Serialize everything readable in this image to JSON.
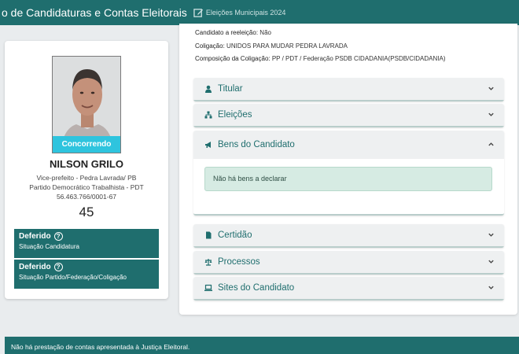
{
  "header": {
    "title": "o de Candidaturas e Contas Eleitorais",
    "subtitle": "Eleições Municipais 2024",
    "edit_icon": "edit-icon"
  },
  "candidate": {
    "status_badge": "Concorrendo",
    "name": "NILSON GRILO",
    "office": "Vice-prefeito - Pedra Lavrada/ PB",
    "party": "Partido Democrático Trabalhista - PDT",
    "cnpj": "56.463.766/0001-67",
    "number": "45",
    "statuses": [
      {
        "title": "Deferido",
        "subtitle": "Situação Candidatura",
        "icon": "question-circle-icon"
      },
      {
        "title": "Deferido",
        "subtitle": "Situação Partido/Federação/Coligação",
        "icon": "question-circle-icon"
      }
    ]
  },
  "details": {
    "reelection_label": "Candidato a reeleição:",
    "reelection_value": "Não",
    "coalition_label": "Coligação:",
    "coalition_value": "UNIDOS PARA MUDAR PEDRA LAVRADA",
    "composition_label": "Composição da Coligação:",
    "composition_value": "PP / PDT / Federação PSDB CIDADANIA(PSDB/CIDADANIA)"
  },
  "accordion": [
    {
      "label": "Titular",
      "icon": "user-icon",
      "expanded": false
    },
    {
      "label": "Eleições",
      "icon": "sitemap-icon",
      "expanded": false
    },
    {
      "label": "Bens do Candidato",
      "icon": "bullhorn-icon",
      "expanded": true,
      "content": "Não há bens a declarar"
    },
    {
      "label": "Certidão",
      "icon": "file-icon",
      "expanded": false
    },
    {
      "label": "Processos",
      "icon": "balance-scale-icon",
      "expanded": false
    },
    {
      "label": "Sites do Candidato",
      "icon": "laptop-icon",
      "expanded": false
    }
  ],
  "footer": {
    "accounts_message": "Não há prestação de contas apresentada à Justiça Eleitoral."
  },
  "colors": {
    "primary": "#1f6e6e",
    "badge": "#2ec4de",
    "alert_bg": "#d6ebe3"
  }
}
